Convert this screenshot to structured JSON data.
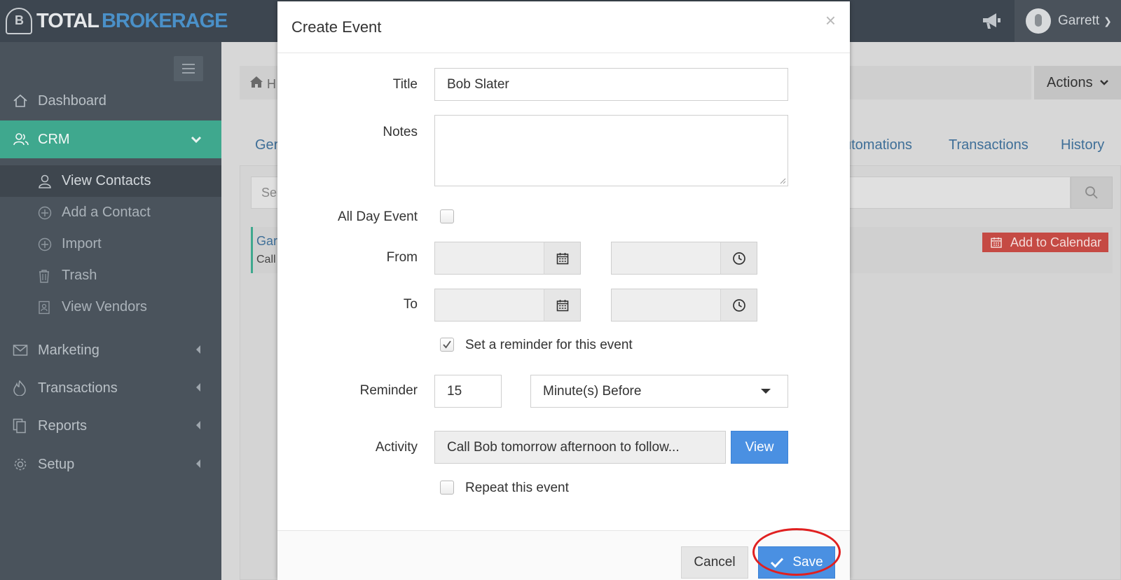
{
  "brand": {
    "part1": "TOTAL",
    "part2": "BROKERAGE",
    "mark": "B"
  },
  "user": {
    "name": "Garrett"
  },
  "sidebar": {
    "items": [
      {
        "label": "Dashboard"
      },
      {
        "label": "CRM"
      },
      {
        "label": "Marketing"
      },
      {
        "label": "Transactions"
      },
      {
        "label": "Reports"
      },
      {
        "label": "Setup"
      }
    ],
    "crm_sub": [
      {
        "label": "View Contacts"
      },
      {
        "label": "Add a Contact"
      },
      {
        "label": "Import"
      },
      {
        "label": "Trash"
      },
      {
        "label": "View Vendors"
      }
    ]
  },
  "background": {
    "breadcrumb_partial": "H",
    "actions_label": "Actions",
    "tabs": [
      {
        "label": "Ger"
      },
      {
        "label": "utomations"
      },
      {
        "label": "Transactions"
      },
      {
        "label": "History"
      }
    ],
    "search_partial": "Se",
    "activity_name_partial": "Gar",
    "activity_sub_partial": "Call",
    "add_to_calendar_label": "Add to Calendar"
  },
  "modal": {
    "title": "Create Event",
    "close_glyph": "×",
    "labels": {
      "title": "Title",
      "notes": "Notes",
      "all_day": "All Day Event",
      "from": "From",
      "to": "To",
      "reminder": "Reminder",
      "activity": "Activity"
    },
    "fields": {
      "title_value": "Bob Slater",
      "notes_value": "",
      "from_date": "",
      "from_time": "",
      "to_date": "",
      "to_time": "",
      "reminder_amount": "15",
      "reminder_unit": "Minute(s) Before",
      "activity_value": "Call Bob tomorrow afternoon to follow..."
    },
    "checkboxes": {
      "all_day_checked": false,
      "set_reminder_label": "Set a reminder for this event",
      "set_reminder_checked": true,
      "repeat_label": "Repeat this event",
      "repeat_checked": false
    },
    "buttons": {
      "view": "View",
      "cancel": "Cancel",
      "save": "Save"
    }
  },
  "colors": {
    "topbar": "#3d4650",
    "sidebar": "#4a535c",
    "crm_active": "#3fa88e",
    "primary_button": "#4a90e2",
    "add_calendar": "#c54a44",
    "highlight": "#e02020"
  }
}
